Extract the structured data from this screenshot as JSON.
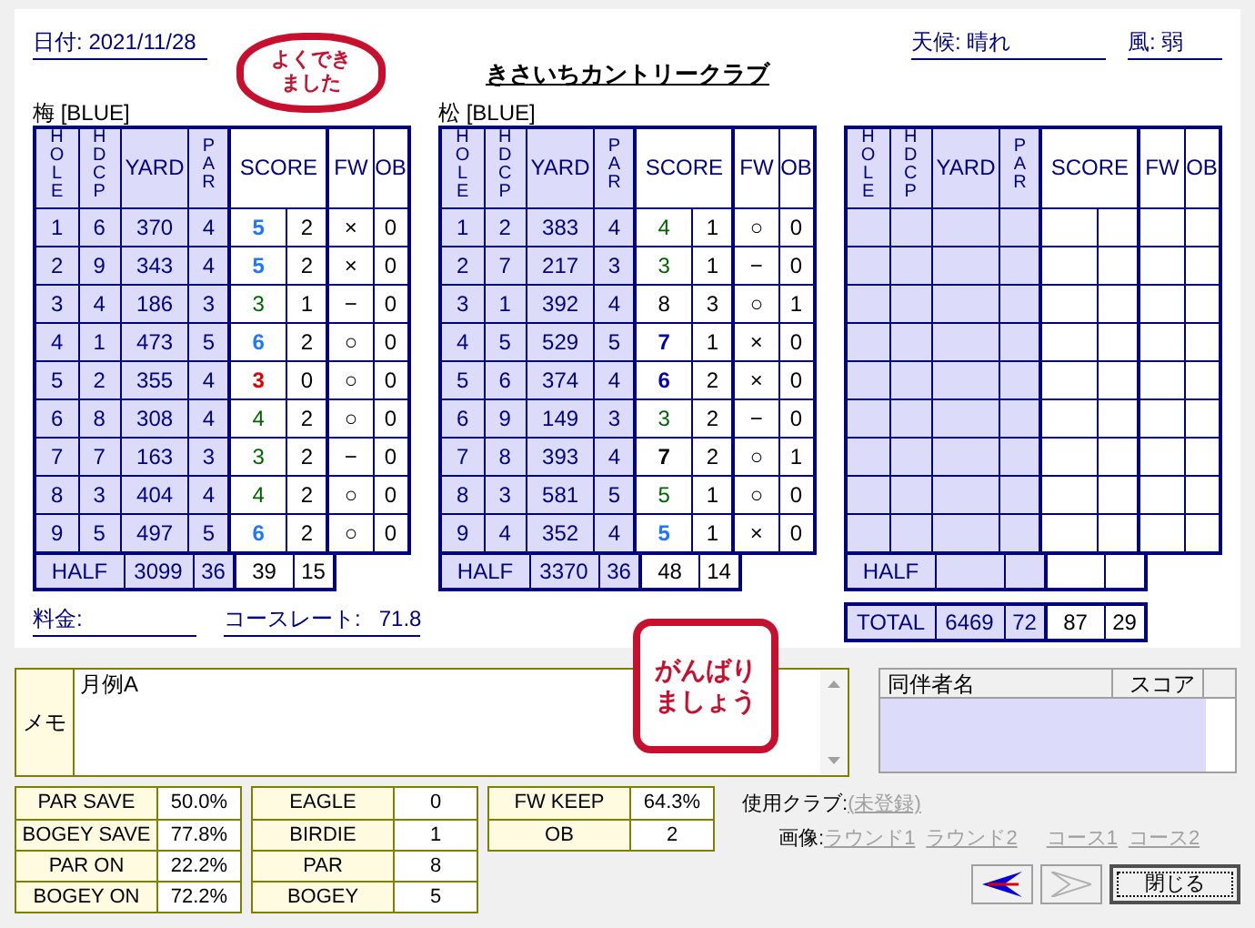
{
  "date": {
    "label": "日付:",
    "value": "2021/11/28"
  },
  "course_name": "きさいちカントリークラブ",
  "weather": {
    "label": "天候:",
    "value": "晴れ"
  },
  "wind": {
    "label": "風:",
    "value": "弱"
  },
  "stamp_top": {
    "lines": [
      "よくでき",
      "ました"
    ]
  },
  "halves": [
    {
      "course": "梅 [BLUE]",
      "columns": [
        "HOLE",
        "HDCP",
        "YARD",
        "PAR",
        "SCORE",
        "FW",
        "OB"
      ],
      "rows": [
        {
          "hole": "1",
          "hdcp": "6",
          "yard": "370",
          "par": "4",
          "score": "5",
          "kind": "bogey",
          "putts": "2",
          "fw": "×",
          "ob": "0"
        },
        {
          "hole": "2",
          "hdcp": "9",
          "yard": "343",
          "par": "4",
          "score": "5",
          "kind": "bogey",
          "putts": "2",
          "fw": "×",
          "ob": "0"
        },
        {
          "hole": "3",
          "hdcp": "4",
          "yard": "186",
          "par": "3",
          "score": "3",
          "kind": "par",
          "putts": "1",
          "fw": "−",
          "ob": "0"
        },
        {
          "hole": "4",
          "hdcp": "1",
          "yard": "473",
          "par": "5",
          "score": "6",
          "kind": "bogey",
          "putts": "2",
          "fw": "○",
          "ob": "0"
        },
        {
          "hole": "5",
          "hdcp": "2",
          "yard": "355",
          "par": "4",
          "score": "3",
          "kind": "birdie",
          "putts": "0",
          "fw": "○",
          "ob": "0"
        },
        {
          "hole": "6",
          "hdcp": "8",
          "yard": "308",
          "par": "4",
          "score": "4",
          "kind": "par",
          "putts": "2",
          "fw": "○",
          "ob": "0"
        },
        {
          "hole": "7",
          "hdcp": "7",
          "yard": "163",
          "par": "3",
          "score": "3",
          "kind": "par",
          "putts": "2",
          "fw": "−",
          "ob": "0"
        },
        {
          "hole": "8",
          "hdcp": "3",
          "yard": "404",
          "par": "4",
          "score": "4",
          "kind": "par",
          "putts": "2",
          "fw": "○",
          "ob": "0"
        },
        {
          "hole": "9",
          "hdcp": "5",
          "yard": "497",
          "par": "5",
          "score": "6",
          "kind": "bogey",
          "putts": "2",
          "fw": "○",
          "ob": "0"
        }
      ],
      "half": {
        "label": "HALF",
        "yard": "3099",
        "par": "36",
        "score": "39",
        "putts": "15"
      }
    },
    {
      "course": "松 [BLUE]",
      "columns": [
        "HOLE",
        "HDCP",
        "YARD",
        "PAR",
        "SCORE",
        "FW",
        "OB"
      ],
      "rows": [
        {
          "hole": "1",
          "hdcp": "2",
          "yard": "383",
          "par": "4",
          "score": "4",
          "kind": "par",
          "putts": "1",
          "fw": "○",
          "ob": "0"
        },
        {
          "hole": "2",
          "hdcp": "7",
          "yard": "217",
          "par": "3",
          "score": "3",
          "kind": "par",
          "putts": "1",
          "fw": "−",
          "ob": "0"
        },
        {
          "hole": "3",
          "hdcp": "1",
          "yard": "392",
          "par": "4",
          "score": "8",
          "kind": "worse",
          "putts": "3",
          "fw": "○",
          "ob": "1"
        },
        {
          "hole": "4",
          "hdcp": "5",
          "yard": "529",
          "par": "5",
          "score": "7",
          "kind": "double_bogey",
          "putts": "1",
          "fw": "×",
          "ob": "0"
        },
        {
          "hole": "5",
          "hdcp": "6",
          "yard": "374",
          "par": "4",
          "score": "6",
          "kind": "double_bogey",
          "putts": "2",
          "fw": "×",
          "ob": "0"
        },
        {
          "hole": "6",
          "hdcp": "9",
          "yard": "149",
          "par": "3",
          "score": "3",
          "kind": "par",
          "putts": "2",
          "fw": "−",
          "ob": "0"
        },
        {
          "hole": "7",
          "hdcp": "8",
          "yard": "393",
          "par": "4",
          "score": "7",
          "kind": "triple_bogey",
          "putts": "2",
          "fw": "○",
          "ob": "1"
        },
        {
          "hole": "8",
          "hdcp": "3",
          "yard": "581",
          "par": "5",
          "score": "5",
          "kind": "par",
          "putts": "1",
          "fw": "○",
          "ob": "0"
        },
        {
          "hole": "9",
          "hdcp": "4",
          "yard": "352",
          "par": "4",
          "score": "5",
          "kind": "bogey",
          "putts": "1",
          "fw": "×",
          "ob": "0"
        }
      ],
      "half": {
        "label": "HALF",
        "yard": "3370",
        "par": "36",
        "score": "48",
        "putts": "14"
      }
    },
    {
      "columns": [
        "HOLE",
        "HDCP",
        "YARD",
        "PAR",
        "SCORE",
        "FW",
        "OB"
      ],
      "half": {
        "label": "HALF"
      }
    }
  ],
  "total": {
    "label": "TOTAL",
    "yard": "6469",
    "par": "72",
    "score": "87",
    "putts": "29"
  },
  "fee": {
    "label": "料金:"
  },
  "course_rate": {
    "label": "コースレート:",
    "value": "71.8"
  },
  "stamp_bottom": {
    "lines": [
      "がんばり",
      "ましょう"
    ]
  },
  "memo": {
    "label": "メモ",
    "value": "月例A"
  },
  "companions": {
    "columns": [
      "同伴者名",
      "スコア"
    ]
  },
  "stats": [
    [
      {
        "label": "PAR SAVE",
        "value": "50.0%"
      },
      {
        "label": "BOGEY SAVE",
        "value": "77.8%"
      },
      {
        "label": "PAR ON",
        "value": "22.2%"
      },
      {
        "label": "BOGEY ON",
        "value": "72.2%"
      }
    ],
    [
      {
        "label": "EAGLE",
        "value": "0"
      },
      {
        "label": "BIRDIE",
        "value": "1"
      },
      {
        "label": "PAR",
        "value": "8"
      },
      {
        "label": "BOGEY",
        "value": "5"
      }
    ],
    [
      {
        "label": "FW KEEP",
        "value": "64.3%"
      },
      {
        "label": "OB",
        "value": "2"
      }
    ]
  ],
  "club": {
    "label": "使用クラブ:",
    "value": "(未登録)"
  },
  "images": {
    "label": "画像:",
    "links": [
      "ラウンド1",
      "ラウンド2",
      "コース1",
      "コース2"
    ]
  },
  "nav": {
    "prev_disabled": false,
    "next_disabled": true,
    "close": "閉じる"
  }
}
